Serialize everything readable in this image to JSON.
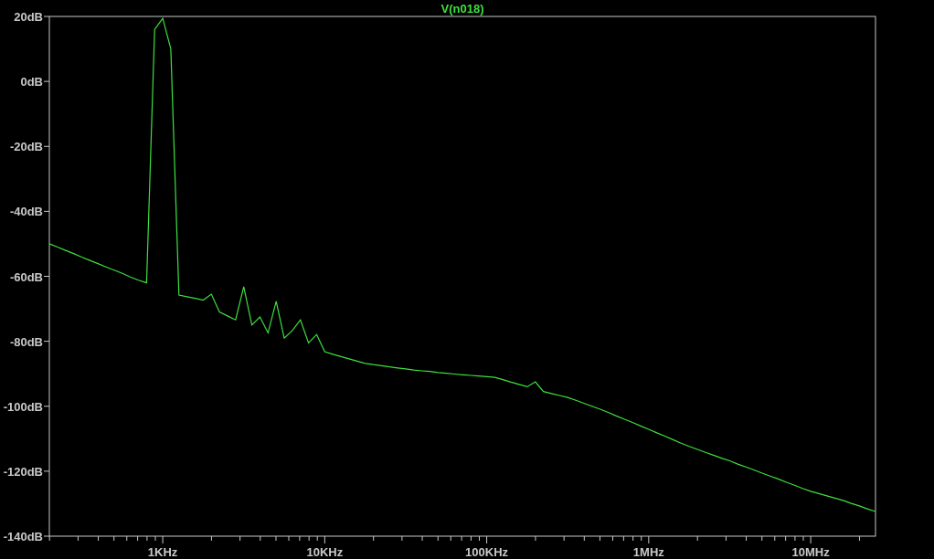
{
  "plot": {
    "chart_data": {
      "type": "line",
      "ylim": [
        -140,
        20
      ],
      "yticks": [
        {
          "value": 20,
          "label": "20dB"
        },
        {
          "value": 0,
          "label": "0dB"
        },
        {
          "value": -20,
          "label": "-20dB"
        },
        {
          "value": -40,
          "label": "-40dB"
        },
        {
          "value": -60,
          "label": "-60dB"
        },
        {
          "value": -80,
          "label": "-80dB"
        },
        {
          "value": -100,
          "label": "-100dB"
        },
        {
          "value": -120,
          "label": "-120dB"
        },
        {
          "value": -140,
          "label": "-140dB"
        }
      ],
      "categories": [
        null,
        null,
        null,
        null,
        null,
        null,
        null,
        null,
        null,
        null,
        null,
        null,
        null,
        null,
        "1KHz",
        null,
        null,
        null,
        null,
        null,
        null,
        null,
        null,
        null,
        null,
        null,
        null,
        null,
        null,
        null,
        null,
        null,
        null,
        null,
        "10KHz",
        null,
        null,
        null,
        null,
        null,
        null,
        null,
        null,
        null,
        null,
        null,
        null,
        null,
        null,
        null,
        null,
        null,
        null,
        null,
        "100KHz",
        null,
        null,
        null,
        null,
        null,
        null,
        null,
        null,
        null,
        null,
        null,
        null,
        null,
        null,
        null,
        null,
        null,
        null,
        null,
        "1MHz",
        null,
        null,
        null,
        null,
        null,
        null,
        null,
        null,
        null,
        null,
        null,
        null,
        null,
        null,
        null,
        null,
        null,
        null,
        null,
        "10MHz",
        null,
        null,
        null,
        null,
        null,
        null,
        null,
        null
      ],
      "series": [
        {
          "name": "V(n018)",
          "color": "#3ee03e",
          "values": [
            -50,
            -51,
            -52,
            -53,
            -54.1,
            -55.1,
            -56.1,
            -57.1,
            -58.1,
            -59.1,
            -60.2,
            -61.2,
            -62,
            16,
            19.4,
            10,
            -65.8,
            -66.3,
            -66.8,
            -67.3,
            -65.5,
            -71,
            -72.2,
            -73.4,
            -63.2,
            -75,
            -72.5,
            -77.4,
            -67.7,
            -79,
            -76.7,
            -73.4,
            -80.5,
            -77.9,
            -83.2,
            -84,
            -84.7,
            -85.4,
            -86.1,
            -86.8,
            -87.2,
            -87.5,
            -87.9,
            -88.2,
            -88.5,
            -88.85,
            -89.1,
            -89.3,
            -89.6,
            -89.85,
            -90.1,
            -90.3,
            -90.5,
            -90.7,
            -90.9,
            -91.1,
            -91.8,
            -92.6,
            -93.3,
            -94,
            -92.5,
            -95.5,
            -96.1,
            -96.7,
            -97.3,
            -98.2,
            -99.1,
            -100,
            -100.9,
            -101.9,
            -103,
            -104,
            -105,
            -106.1,
            -107.1,
            -108.2,
            -109.2,
            -110.3,
            -111.4,
            -112.4,
            -113.3,
            -114.2,
            -115.1,
            -116,
            -116.8,
            -117.8,
            -118.7,
            -119.6,
            -120.6,
            -121.5,
            -122.4,
            -123.4,
            -124.3,
            -125.3,
            -126.2,
            -126.9,
            -127.6,
            -128.3,
            -129,
            -129.9,
            -130.7,
            -131.6,
            -132.4
          ]
        }
      ]
    }
  }
}
